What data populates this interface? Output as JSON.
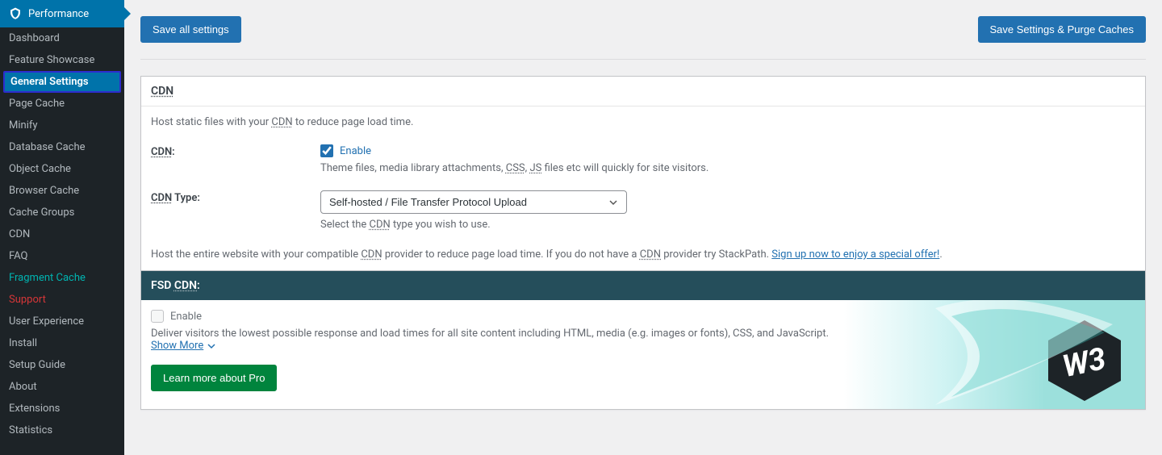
{
  "sidebar": {
    "header": "Performance",
    "items": [
      {
        "label": "Dashboard"
      },
      {
        "label": "Feature Showcase"
      },
      {
        "label": "General Settings",
        "active": true
      },
      {
        "label": "Page Cache"
      },
      {
        "label": "Minify"
      },
      {
        "label": "Database Cache"
      },
      {
        "label": "Object Cache"
      },
      {
        "label": "Browser Cache"
      },
      {
        "label": "Cache Groups"
      },
      {
        "label": "CDN"
      },
      {
        "label": "FAQ"
      },
      {
        "label": "Fragment Cache",
        "teal": true
      },
      {
        "label": "Support",
        "red": true
      },
      {
        "label": "User Experience"
      },
      {
        "label": "Install"
      },
      {
        "label": "Setup Guide"
      },
      {
        "label": "About"
      },
      {
        "label": "Extensions"
      },
      {
        "label": "Statistics"
      }
    ]
  },
  "topbar": {
    "save_all": "Save all settings",
    "save_purge": "Save Settings & Purge Caches"
  },
  "cdn_panel": {
    "title": "CDN",
    "intro_pre": "Host static files with your ",
    "intro_abbr": "CDN",
    "intro_post": " to reduce page load time.",
    "cdn_label_abbr": "CDN",
    "cdn_label_suffix": ":",
    "enable_label": "Enable",
    "enable_help_pre": "Theme files, media library attachments, ",
    "enable_help_css": "CSS",
    "enable_help_sep": ", ",
    "enable_help_js": "JS",
    "enable_help_post": " files etc will quickly for site visitors.",
    "type_label_abbr": "CDN",
    "type_label_suffix": " Type:",
    "type_value": "Self-hosted / File Transfer Protocol Upload",
    "type_help_pre": "Select the ",
    "type_help_abbr": "CDN",
    "type_help_post": " type you wish to use.",
    "note_pre": "Host the entire website with your compatible ",
    "note_abbr1": "CDN",
    "note_mid": " provider to reduce page load time. If you do not have a ",
    "note_abbr2": "CDN",
    "note_post": " provider try StackPath. ",
    "note_link": "Sign up now to enjoy a special offer!",
    "note_end": "."
  },
  "fsd_panel": {
    "title_pre": "FSD ",
    "title_abbr": "CDN",
    "title_suffix": ":",
    "enable_label": "Enable",
    "desc": "Deliver visitors the lowest possible response and load times for all site content including HTML, media (e.g. images or fonts), CSS, and JavaScript.",
    "show_more": "Show More",
    "learn_more": "Learn more about Pro"
  }
}
